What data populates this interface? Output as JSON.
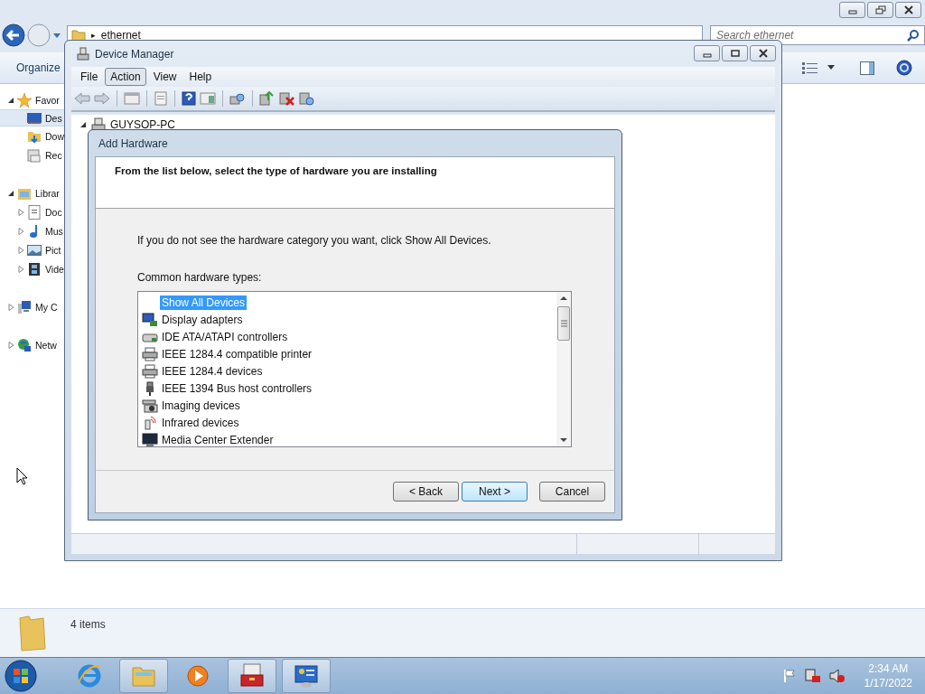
{
  "explorer": {
    "address": {
      "separator": "▸",
      "path": "ethernet"
    },
    "search": {
      "placeholder": "Search ethernet"
    },
    "toolbar": {
      "organize": "Organize"
    },
    "nav": [
      {
        "label": "Favor",
        "kind": "star",
        "expanded": true,
        "selected": false,
        "children": [
          {
            "label": "Des",
            "kind": "desktop",
            "selected": true
          },
          {
            "label": "Dow",
            "kind": "downloads",
            "selected": false
          },
          {
            "label": "Rec",
            "kind": "recent",
            "selected": false
          }
        ]
      },
      {
        "label": "Librar",
        "kind": "library",
        "expanded": true,
        "selected": false,
        "children": [
          {
            "label": "Doc",
            "kind": "document",
            "expanded": false,
            "selected": false
          },
          {
            "label": "Mus",
            "kind": "music",
            "expanded": false,
            "selected": false
          },
          {
            "label": "Pict",
            "kind": "pictures",
            "expanded": false,
            "selected": false
          },
          {
            "label": "Vide",
            "kind": "videos",
            "expanded": false,
            "selected": false
          }
        ]
      },
      {
        "label": "My C",
        "kind": "computer",
        "expanded": false,
        "selected": false
      },
      {
        "label": "Netw",
        "kind": "network",
        "expanded": false,
        "selected": false
      }
    ],
    "details": {
      "count": "4 items"
    }
  },
  "device_manager": {
    "title": "Device Manager",
    "menu": [
      {
        "label": "File",
        "selected": false
      },
      {
        "label": "Action",
        "selected": true
      },
      {
        "label": "View",
        "selected": false
      },
      {
        "label": "Help",
        "selected": false
      }
    ],
    "tree": {
      "root": "GUYSOP-PC",
      "expanded": true
    }
  },
  "add_hardware": {
    "title": "Add Hardware",
    "heading": "From the list below, select the type of hardware you are installing",
    "instruction": "If you do not see the hardware category you want, click Show All Devices.",
    "list_label": "Common hardware types:",
    "items": [
      {
        "label": "Show All Devices",
        "kind": "none",
        "selected": true
      },
      {
        "label": "Display adapters",
        "kind": "display",
        "selected": false
      },
      {
        "label": "IDE ATA/ATAPI controllers",
        "kind": "drive",
        "selected": false
      },
      {
        "label": "IEEE 1284.4 compatible printer",
        "kind": "printer",
        "selected": false
      },
      {
        "label": "IEEE 1284.4 devices",
        "kind": "printer",
        "selected": false
      },
      {
        "label": "IEEE 1394 Bus host controllers",
        "kind": "plug",
        "selected": false
      },
      {
        "label": "Imaging devices",
        "kind": "camera",
        "selected": false
      },
      {
        "label": "Infrared devices",
        "kind": "infrared",
        "selected": false
      },
      {
        "label": "Media Center Extender",
        "kind": "monitor",
        "selected": false
      }
    ],
    "buttons": [
      {
        "label": "< Back",
        "default": false
      },
      {
        "label": "Next >",
        "default": true
      },
      {
        "label": "Cancel",
        "default": false
      }
    ]
  },
  "taskbar": {
    "apps": [
      {
        "kind": "browser",
        "active": false
      },
      {
        "kind": "folder",
        "active": true
      },
      {
        "kind": "media",
        "active": false
      },
      {
        "kind": "toolbox",
        "active": true
      },
      {
        "kind": "panel",
        "active": true
      }
    ],
    "time": "2:34 AM",
    "date": "1/17/2022"
  }
}
